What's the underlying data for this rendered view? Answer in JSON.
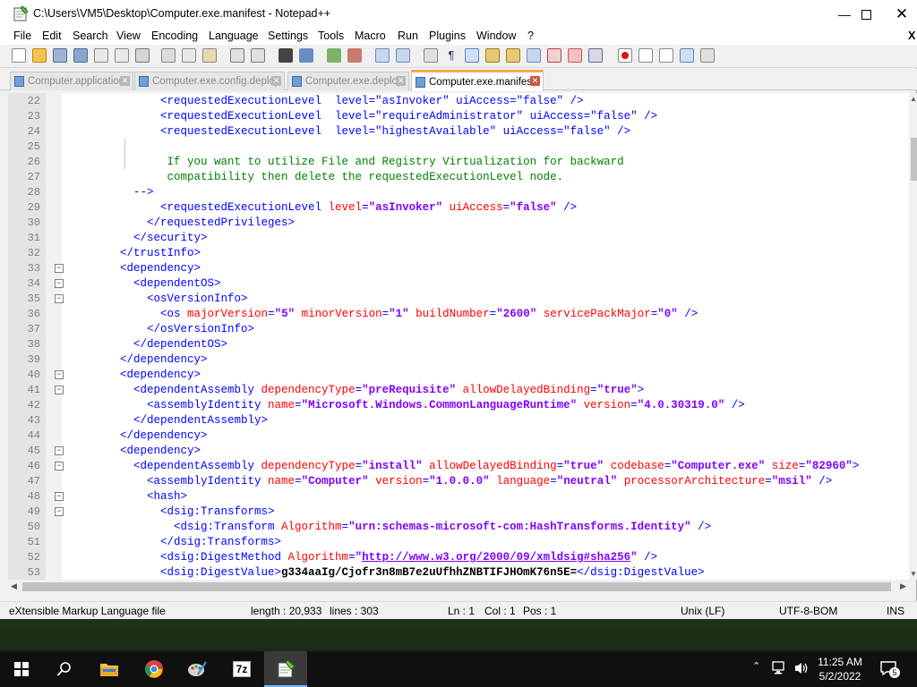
{
  "window": {
    "title": "C:\\Users\\VM5\\Desktop\\Computer.exe.manifest - Notepad++"
  },
  "menu": [
    "File",
    "Edit",
    "Search",
    "View",
    "Encoding",
    "Language",
    "Settings",
    "Tools",
    "Macro",
    "Run",
    "Plugins",
    "Window",
    "?"
  ],
  "window_close_x": "X",
  "tabs": [
    {
      "label": "Computer.application",
      "active": false
    },
    {
      "label": "Computer.exe.config.deploy",
      "active": false
    },
    {
      "label": "Computer.exe.deploy",
      "active": false
    },
    {
      "label": "Computer.exe.manifest",
      "active": true
    }
  ],
  "editor": {
    "lines": [
      {
        "n": "22",
        "fold": "",
        "tokens": [
          [
            "txt",
            "            "
          ],
          [
            "tag",
            "<requestedExecutionLevel  level=\"asInvoker\" uiAccess=\"false\" />"
          ]
        ]
      },
      {
        "n": "23",
        "fold": "",
        "tokens": [
          [
            "txt",
            "            "
          ],
          [
            "tag",
            "<requestedExecutionLevel  level=\"requireAdministrator\" uiAccess=\"false\" />"
          ]
        ]
      },
      {
        "n": "24",
        "fold": "",
        "tokens": [
          [
            "txt",
            "            "
          ],
          [
            "tag",
            "<requestedExecutionLevel  level=\"highestAvailable\" uiAccess=\"false\" />"
          ]
        ]
      },
      {
        "n": "25",
        "fold": "",
        "tokens": []
      },
      {
        "n": "26",
        "fold": "",
        "tokens": [
          [
            "com",
            "             If you want to utilize File and Registry Virtualization for backward"
          ]
        ]
      },
      {
        "n": "27",
        "fold": "",
        "tokens": [
          [
            "com",
            "             compatibility then delete the requestedExecutionLevel node."
          ]
        ]
      },
      {
        "n": "28",
        "fold": "",
        "tokens": [
          [
            "tag",
            "        -->"
          ]
        ]
      },
      {
        "n": "29",
        "fold": "",
        "tokens": [
          [
            "txt",
            "            "
          ],
          [
            "tag",
            "<requestedExecutionLevel "
          ],
          [
            "attr",
            "level"
          ],
          [
            "tag",
            "="
          ],
          [
            "val",
            "\"asInvoker\""
          ],
          [
            "tag",
            " "
          ],
          [
            "attr",
            "uiAccess"
          ],
          [
            "tag",
            "="
          ],
          [
            "val",
            "\"false\""
          ],
          [
            "tag",
            " />"
          ]
        ]
      },
      {
        "n": "30",
        "fold": "",
        "tokens": [
          [
            "tag",
            "          </requestedPrivileges>"
          ]
        ]
      },
      {
        "n": "31",
        "fold": "",
        "tokens": [
          [
            "tag",
            "        </security>"
          ]
        ]
      },
      {
        "n": "32",
        "fold": "",
        "tokens": [
          [
            "tag",
            "      </trustInfo>"
          ]
        ]
      },
      {
        "n": "33",
        "fold": "-",
        "tokens": [
          [
            "tag",
            "      <dependency>"
          ]
        ]
      },
      {
        "n": "34",
        "fold": "-",
        "tokens": [
          [
            "tag",
            "        <dependentOS>"
          ]
        ]
      },
      {
        "n": "35",
        "fold": "-",
        "tokens": [
          [
            "tag",
            "          <osVersionInfo>"
          ]
        ]
      },
      {
        "n": "36",
        "fold": "",
        "tokens": [
          [
            "tag",
            "            <os "
          ],
          [
            "attr",
            "majorVersion"
          ],
          [
            "tag",
            "="
          ],
          [
            "val",
            "\"5\""
          ],
          [
            "tag",
            " "
          ],
          [
            "attr",
            "minorVersion"
          ],
          [
            "tag",
            "="
          ],
          [
            "val",
            "\"1\""
          ],
          [
            "tag",
            " "
          ],
          [
            "attr",
            "buildNumber"
          ],
          [
            "tag",
            "="
          ],
          [
            "val",
            "\"2600\""
          ],
          [
            "tag",
            " "
          ],
          [
            "attr",
            "servicePackMajor"
          ],
          [
            "tag",
            "="
          ],
          [
            "val",
            "\"0\""
          ],
          [
            "tag",
            " />"
          ]
        ]
      },
      {
        "n": "37",
        "fold": "",
        "tokens": [
          [
            "tag",
            "          </osVersionInfo>"
          ]
        ]
      },
      {
        "n": "38",
        "fold": "",
        "tokens": [
          [
            "tag",
            "        </dependentOS>"
          ]
        ]
      },
      {
        "n": "39",
        "fold": "",
        "tokens": [
          [
            "tag",
            "      </dependency>"
          ]
        ]
      },
      {
        "n": "40",
        "fold": "-",
        "tokens": [
          [
            "tag",
            "      <dependency>"
          ]
        ]
      },
      {
        "n": "41",
        "fold": "-",
        "tokens": [
          [
            "tag",
            "        <dependentAssembly "
          ],
          [
            "attr",
            "dependencyType"
          ],
          [
            "tag",
            "="
          ],
          [
            "val",
            "\"preRequisite\""
          ],
          [
            "tag",
            " "
          ],
          [
            "attr",
            "allowDelayedBinding"
          ],
          [
            "tag",
            "="
          ],
          [
            "val",
            "\"true\""
          ],
          [
            "tag",
            ">"
          ]
        ]
      },
      {
        "n": "42",
        "fold": "",
        "tokens": [
          [
            "tag",
            "          <assemblyIdentity "
          ],
          [
            "attr",
            "name"
          ],
          [
            "tag",
            "="
          ],
          [
            "val",
            "\"Microsoft.Windows.CommonLanguageRuntime\""
          ],
          [
            "tag",
            " "
          ],
          [
            "attr",
            "version"
          ],
          [
            "tag",
            "="
          ],
          [
            "val",
            "\"4.0.30319.0\""
          ],
          [
            "tag",
            " />"
          ]
        ]
      },
      {
        "n": "43",
        "fold": "",
        "tokens": [
          [
            "tag",
            "        </dependentAssembly>"
          ]
        ]
      },
      {
        "n": "44",
        "fold": "",
        "tokens": [
          [
            "tag",
            "      </dependency>"
          ]
        ]
      },
      {
        "n": "45",
        "fold": "-",
        "tokens": [
          [
            "tag",
            "      <dependency>"
          ]
        ]
      },
      {
        "n": "46",
        "fold": "-",
        "tokens": [
          [
            "tag",
            "        <dependentAssembly "
          ],
          [
            "attr",
            "dependencyType"
          ],
          [
            "tag",
            "="
          ],
          [
            "val",
            "\"install\""
          ],
          [
            "tag",
            " "
          ],
          [
            "attr",
            "allowDelayedBinding"
          ],
          [
            "tag",
            "="
          ],
          [
            "val",
            "\"true\""
          ],
          [
            "tag",
            " "
          ],
          [
            "attr",
            "codebase"
          ],
          [
            "tag",
            "="
          ],
          [
            "val",
            "\"Computer.exe\""
          ],
          [
            "tag",
            " "
          ],
          [
            "attr",
            "size"
          ],
          [
            "tag",
            "="
          ],
          [
            "val",
            "\"82960\""
          ],
          [
            "tag",
            ">"
          ]
        ]
      },
      {
        "n": "47",
        "fold": "",
        "tokens": [
          [
            "tag",
            "          <assemblyIdentity "
          ],
          [
            "attr",
            "name"
          ],
          [
            "tag",
            "="
          ],
          [
            "val",
            "\"Computer\""
          ],
          [
            "tag",
            " "
          ],
          [
            "attr",
            "version"
          ],
          [
            "tag",
            "="
          ],
          [
            "val",
            "\"1.0.0.0\""
          ],
          [
            "tag",
            " "
          ],
          [
            "attr",
            "language"
          ],
          [
            "tag",
            "="
          ],
          [
            "val",
            "\"neutral\""
          ],
          [
            "tag",
            " "
          ],
          [
            "attr",
            "processorArchitecture"
          ],
          [
            "tag",
            "="
          ],
          [
            "val",
            "\"msil\""
          ],
          [
            "tag",
            " />"
          ]
        ]
      },
      {
        "n": "48",
        "fold": "-",
        "tokens": [
          [
            "tag",
            "          <hash>"
          ]
        ]
      },
      {
        "n": "49",
        "fold": "-",
        "tokens": [
          [
            "tag",
            "            <dsig:Transforms>"
          ]
        ]
      },
      {
        "n": "50",
        "fold": "",
        "tokens": [
          [
            "tag",
            "              <dsig:Transform "
          ],
          [
            "attr",
            "Algorithm"
          ],
          [
            "tag",
            "="
          ],
          [
            "val",
            "\"urn:schemas-microsoft-com:HashTransforms.Identity\""
          ],
          [
            "tag",
            " />"
          ]
        ]
      },
      {
        "n": "51",
        "fold": "",
        "tokens": [
          [
            "tag",
            "            </dsig:Transforms>"
          ]
        ]
      },
      {
        "n": "52",
        "fold": "",
        "tokens": [
          [
            "tag",
            "            <dsig:DigestMethod "
          ],
          [
            "attr",
            "Algorithm"
          ],
          [
            "tag",
            "="
          ],
          [
            "val",
            "\""
          ],
          [
            "url",
            "http://www.w3.org/2000/09/xmldsig#sha256"
          ],
          [
            "val",
            "\""
          ],
          [
            "tag",
            " />"
          ]
        ]
      },
      {
        "n": "53",
        "fold": "",
        "tokens": [
          [
            "tag",
            "            <dsig:DigestValue>"
          ],
          [
            "txt",
            "g334aaIg/Cjofr3n8mB7e2uUfhhZNBTIFJHOmK76n5E="
          ],
          [
            "tag",
            "</dsig:DigestValue>"
          ]
        ]
      }
    ]
  },
  "status": {
    "file_type": "eXtensible Markup Language file",
    "length": "length : 20,933",
    "lines": "lines : 303",
    "ln": "Ln : 1",
    "col": "Col : 1",
    "pos": "Pos : 1",
    "eol": "Unix (LF)",
    "encoding": "UTF-8-BOM",
    "mode": "INS"
  },
  "taskbar": {
    "clock_time": "11:25 AM",
    "clock_date": "5/2/2022",
    "notification_count": "5",
    "sevenzip_label": "7z"
  }
}
